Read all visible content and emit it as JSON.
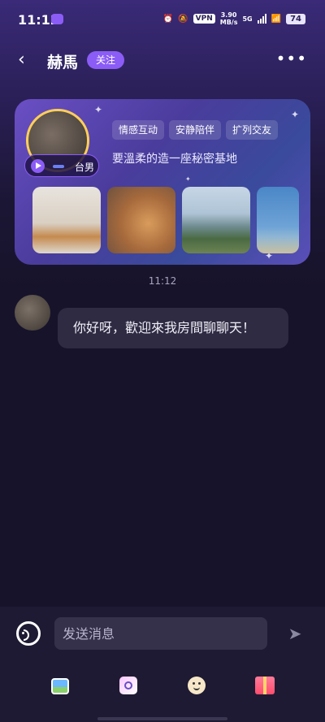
{
  "status_bar": {
    "time": "11:12",
    "vpn": "VPN",
    "speed_value": "3.90",
    "speed_unit": "MB/s",
    "network": "5G",
    "battery": "74"
  },
  "header": {
    "back_icon": "chevron-left-icon",
    "name": "赫馬",
    "follow_label": "关注",
    "more_icon": "more-dots-icon"
  },
  "profile_card": {
    "gender_label": "台男",
    "tags": [
      "情感互动",
      "安静陪伴",
      "扩列交友"
    ],
    "signature": "要溫柔的造一座秘密基地",
    "photos": [
      "cats-photo",
      "cat-closeup-photo",
      "mountain-landscape-photo",
      "sea-photo"
    ]
  },
  "chat": {
    "timestamp": "11:12",
    "messages": [
      {
        "from": "other",
        "text": "你好呀，歡迎來我房間聊聊天！"
      }
    ]
  },
  "input_bar": {
    "placeholder": "发送消息",
    "tools": [
      "image-icon",
      "camera-icon",
      "emoji-icon",
      "gift-icon"
    ]
  },
  "colors": {
    "accent": "#8b5cf6",
    "background": "#17132a",
    "bubble": "#2e2b42"
  }
}
